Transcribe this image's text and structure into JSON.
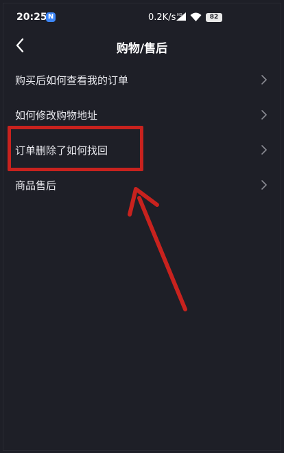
{
  "status_bar": {
    "time": "20:25",
    "notification_badge": "N",
    "network_speed": "0.2K/s",
    "battery_level": "82"
  },
  "nav": {
    "title": "购物/售后"
  },
  "menu_items": [
    {
      "label": "购买后如何查看我的订单"
    },
    {
      "label": "如何修改购物地址"
    },
    {
      "label": "订单删除了如何找回"
    },
    {
      "label": "商品售后"
    }
  ],
  "colors": {
    "background": "#1e1f27",
    "text": "#e9e9ee",
    "annotation_red": "#c8221e",
    "chevron": "#8a8b92"
  },
  "icons": {
    "back": "chevron-left-icon",
    "row_arrow": "chevron-right-icon",
    "signal": "signal-icon",
    "wifi": "wifi-icon",
    "battery": "battery-icon"
  }
}
